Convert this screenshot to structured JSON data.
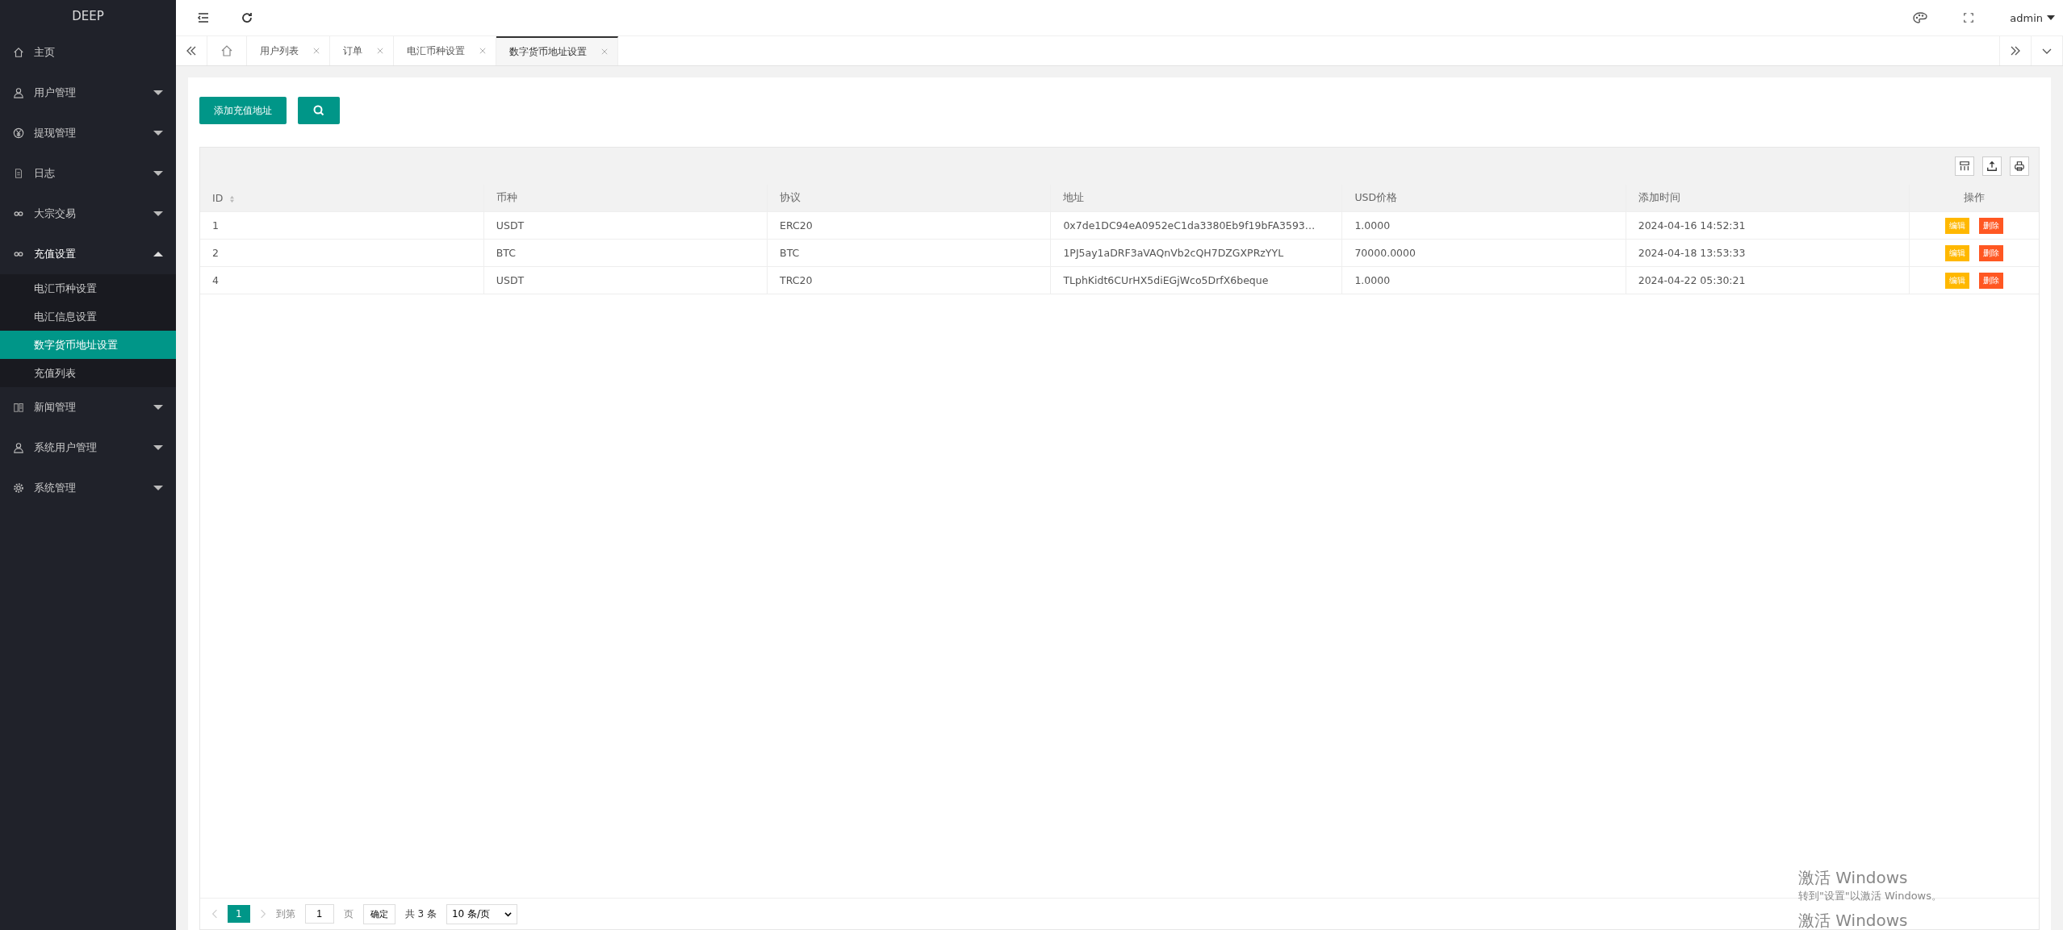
{
  "sidebar": {
    "logo": "DEEP",
    "items": [
      {
        "label": "主页"
      },
      {
        "label": "用户管理",
        "expanded": false
      },
      {
        "label": "提现管理",
        "expanded": false
      },
      {
        "label": "日志",
        "expanded": false
      },
      {
        "label": "大宗交易",
        "expanded": false
      },
      {
        "label": "充值设置",
        "expanded": true,
        "children": [
          {
            "label": "电汇币种设置",
            "selected": false
          },
          {
            "label": "电汇信息设置",
            "selected": false
          },
          {
            "label": "数字货币地址设置",
            "selected": true
          },
          {
            "label": "充值列表",
            "selected": false
          }
        ]
      },
      {
        "label": "新闻管理",
        "expanded": false
      },
      {
        "label": "系统用户管理",
        "expanded": false
      },
      {
        "label": "系统管理",
        "expanded": false
      }
    ]
  },
  "header": {
    "user": "admin"
  },
  "tabs": [
    {
      "label": "用户列表",
      "selected": false
    },
    {
      "label": "订单",
      "selected": false
    },
    {
      "label": "电汇币种设置",
      "selected": false
    },
    {
      "label": "数字货币地址设置",
      "selected": true
    }
  ],
  "toolbar": {
    "add_button": "添加充值地址"
  },
  "table": {
    "columns": [
      {
        "label": "ID",
        "sortable": true
      },
      {
        "label": "币种",
        "sortable": false
      },
      {
        "label": "协议",
        "sortable": false
      },
      {
        "label": "地址",
        "sortable": false
      },
      {
        "label": "USD价格",
        "sortable": false
      },
      {
        "label": "添加时间",
        "sortable": false
      },
      {
        "label": "操作",
        "sortable": false
      }
    ],
    "rows": [
      {
        "cells": [
          "1",
          "USDT",
          "ERC20",
          "0x7de1DC94eA0952eC1da3380Eb9f19bFA3593…",
          "1.0000",
          "2024-04-16 14:52:31"
        ],
        "actions": [
          "编辑",
          "删除"
        ]
      },
      {
        "cells": [
          "2",
          "BTC",
          "BTC",
          "1PJ5ay1aDRF3aVAQnVb2cQH7DZGXPRzYYL",
          "70000.0000",
          "2024-04-18 13:53:33"
        ],
        "actions": [
          "编辑",
          "删除"
        ]
      },
      {
        "cells": [
          "4",
          "USDT",
          "TRC20",
          "TLphKidt6CUrHX5diEGjWco5DrfX6beque",
          "1.0000",
          "2024-04-22 05:30:21"
        ],
        "actions": [
          "编辑",
          "删除"
        ]
      }
    ]
  },
  "pagination": {
    "page": "1",
    "goto_label": "到第",
    "goto_value": "1",
    "page_unit": "页",
    "confirm": "确定",
    "total": "共 3 条",
    "page_size": "10 条/页"
  },
  "activation": [
    {
      "title": "激活 Windows",
      "hint": "转到\"设置\"以激活 Windows。"
    },
    {
      "title": "激活 Windows"
    }
  ]
}
